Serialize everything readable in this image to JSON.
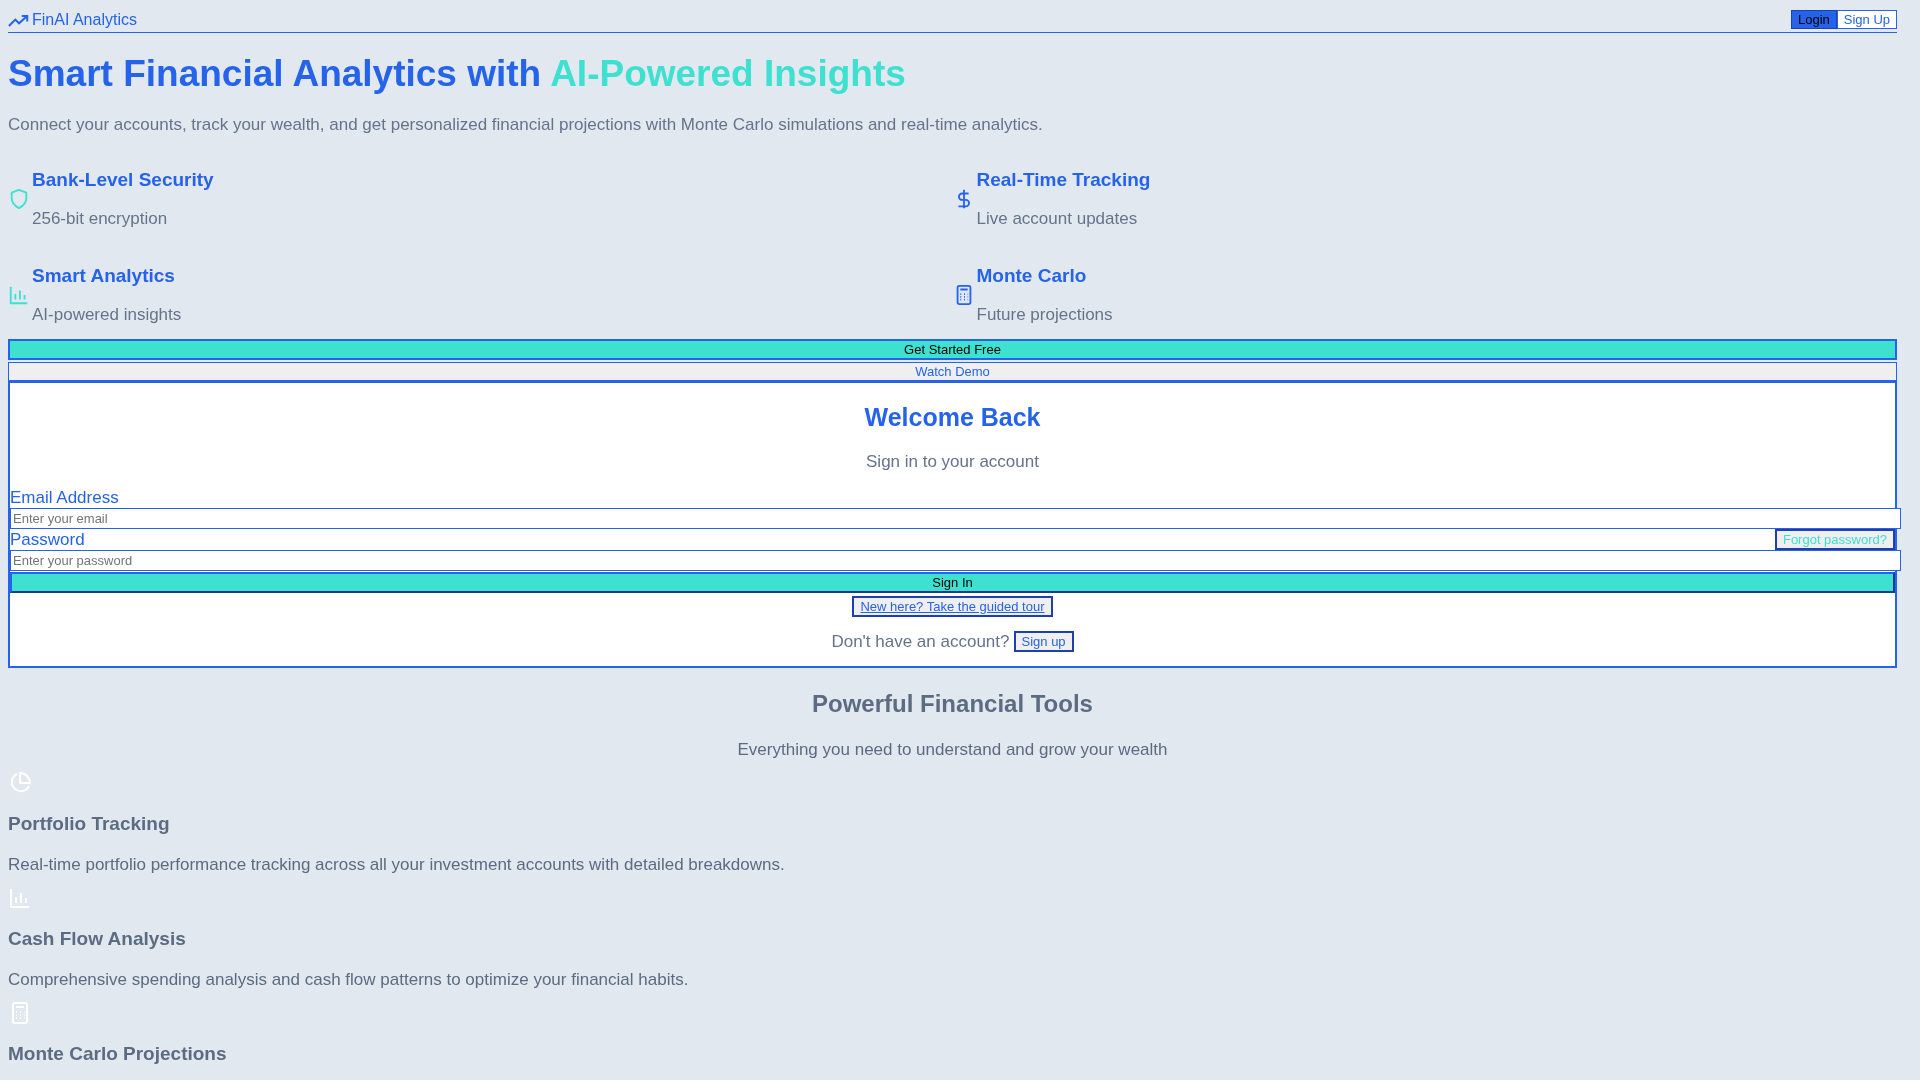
{
  "header": {
    "brand": "FinAI Analytics",
    "buttons": [
      {
        "label": "Login",
        "selected": true
      },
      {
        "label": "Sign Up",
        "selected": false
      }
    ]
  },
  "hero": {
    "title": "Smart Financial Analytics with",
    "title_highlight": "AI-Powered Insights",
    "subtitle": "Connect your accounts, track your wealth, and get personalized financial projections with Monte Carlo simulations and real-time analytics.",
    "features": [
      {
        "kind": "shield",
        "title": "Bank-Level Security",
        "subtitle": "256-bit encryption"
      },
      {
        "kind": "dollar",
        "title": "Real-Time Tracking",
        "subtitle": "Live account updates"
      },
      {
        "kind": "bars",
        "title": "Smart Analytics",
        "subtitle": "AI-powered insights"
      },
      {
        "kind": "calculator",
        "title": "Monte Carlo",
        "subtitle": "Future projections"
      }
    ],
    "actions": [
      {
        "kind": "primary",
        "label": "Get Started Free"
      },
      {
        "kind": "secondary",
        "label": "Watch Demo"
      }
    ]
  },
  "login": {
    "title": "Welcome Back",
    "subtitle": "Sign in to your account",
    "fields": [
      {
        "label": "Email Address",
        "placeholder": "Enter your email"
      },
      {
        "label": "Password",
        "placeholder": "Enter your password",
        "link": "Forgot password?"
      }
    ],
    "submit": "Sign In",
    "tour_link": "New here? Take the guided tour",
    "signup_prompt": "Don't have an account?",
    "signup_link": "Sign up"
  },
  "tools": {
    "title": "Powerful Financial Tools",
    "subtitle": "Everything you need to understand and grow your wealth",
    "items": [
      {
        "kind": "pie",
        "title": "Portfolio Tracking",
        "description": "Real-time portfolio performance tracking across all your investment accounts with detailed breakdowns."
      },
      {
        "kind": "bars",
        "title": "Cash Flow Analysis",
        "description": "Comprehensive spending analysis and cash flow patterns to optimize your financial habits."
      },
      {
        "kind": "calculator",
        "title": "Monte Carlo Projections"
      }
    ]
  }
}
